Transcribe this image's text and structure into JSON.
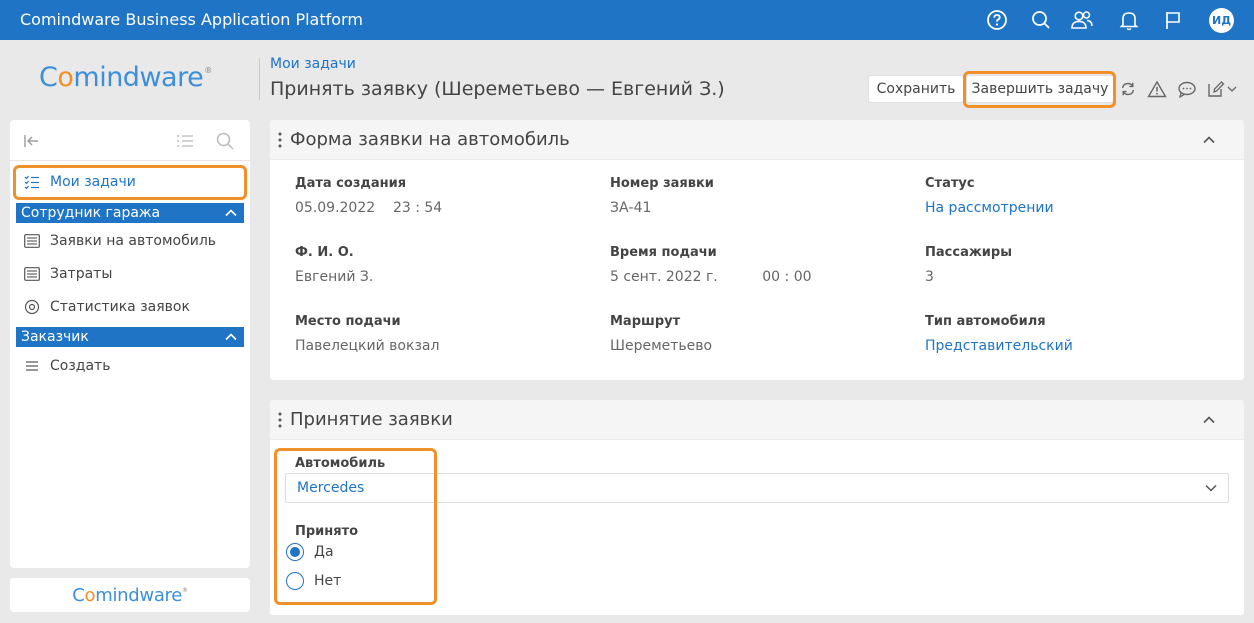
{
  "app": {
    "title": "Comindware Business Application Platform",
    "user_initials": "ИД"
  },
  "logo": {
    "text_a": "C",
    "text_o": "o",
    "text_b": "mindware",
    "registered": "®"
  },
  "header": {
    "breadcrumb": "Мои задачи",
    "title": "Принять заявку (Шереметьево — Евгений З.)",
    "save_label": "Сохранить",
    "complete_label": "Завершить задачу"
  },
  "sidebar": {
    "my_tasks": "Мои задачи",
    "group_garage": "Сотрудник гаража",
    "item_requests": "Заявки на автомобиль",
    "item_costs": "Затраты",
    "item_stats": "Статистика заявок",
    "group_customer": "Заказчик",
    "item_create": "Создать"
  },
  "form": {
    "title": "Форма заявки на автомобиль",
    "fields": [
      {
        "label": "Дата создания",
        "value": "05.09.2022    23 : 54"
      },
      {
        "label": "Номер заявки",
        "value": "ЗА-41"
      },
      {
        "label": "Статус",
        "value": "На рассмотрении"
      },
      {
        "label": "Ф. И. О.",
        "value": "Евгений З."
      },
      {
        "label": "Время подачи",
        "value": "5 сент. 2022 г.          00 : 00"
      },
      {
        "label": "Пассажиры",
        "value": "3"
      },
      {
        "label": "Место подачи",
        "value": "Павелецкий вокзал"
      },
      {
        "label": "Маршрут",
        "value": "Шереметьево"
      },
      {
        "label": "Тип автомобиля",
        "value": "Представительский"
      }
    ]
  },
  "acceptance": {
    "title": "Принятие заявки",
    "car_label": "Автомобиль",
    "car_value": "Mercedes",
    "accepted_label": "Принято",
    "option_yes": "Да",
    "option_no": "Нет",
    "selected": "Да"
  },
  "colors": {
    "brand": "#1f74c5",
    "highlight": "#f0902a",
    "logo_accent": "#f0902a"
  }
}
